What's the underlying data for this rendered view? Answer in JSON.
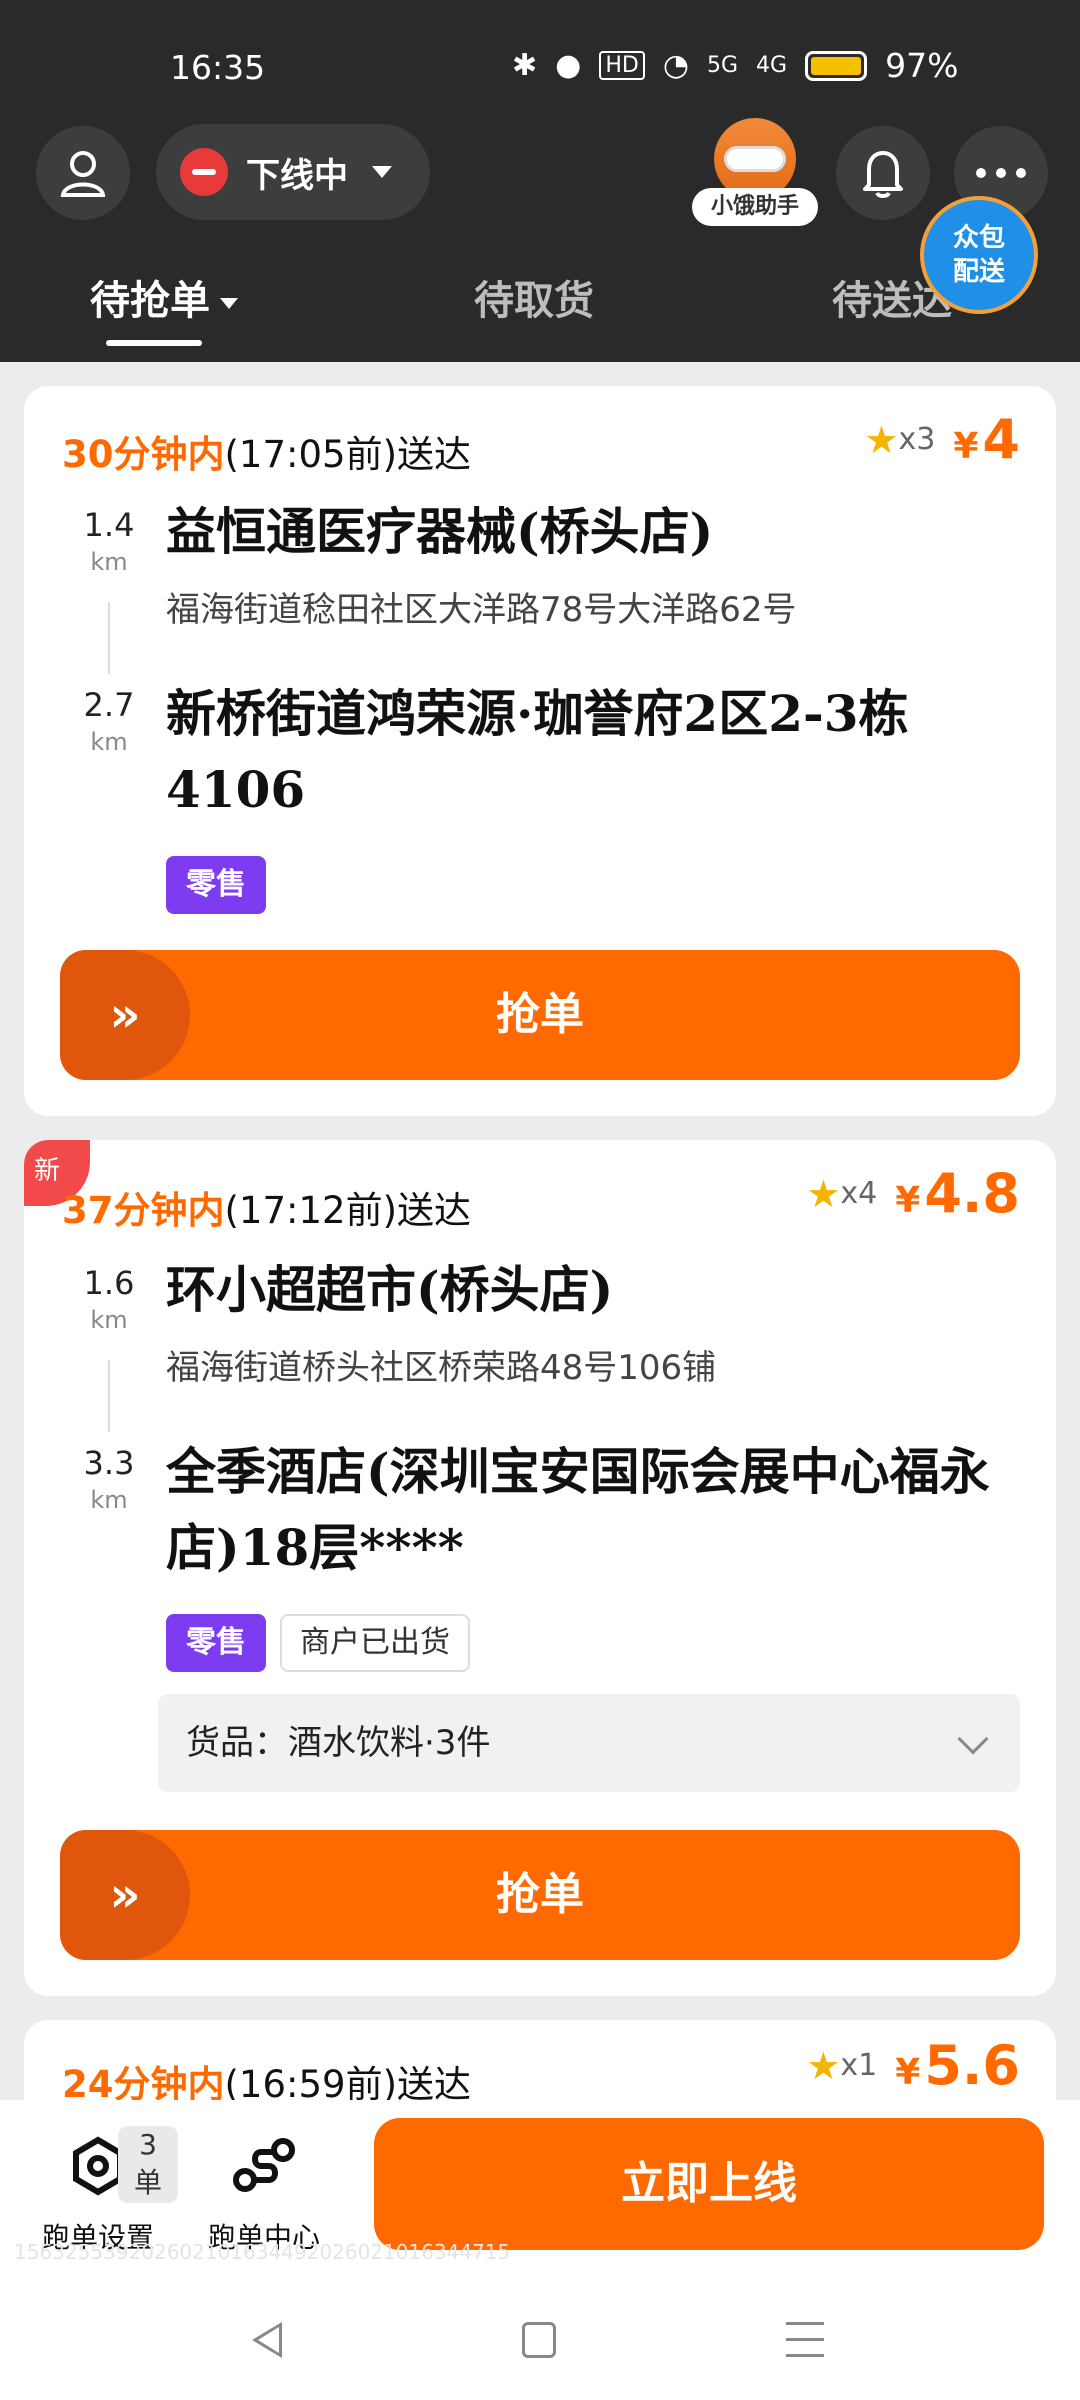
{
  "status_bar": {
    "time": "16:35",
    "network_5g": "5G",
    "network_4g": "4G",
    "hd": "HD",
    "battery": "97%"
  },
  "header": {
    "status_label": "下线中",
    "assistant_label": "小饿助手",
    "crowd_badge": "众包\n配送"
  },
  "tabs": [
    {
      "label": "待抢单",
      "active": true
    },
    {
      "label": "待取货",
      "active": false
    },
    {
      "label": "待送达",
      "active": false
    }
  ],
  "orders": [
    {
      "deliver_minutes": "30分钟内",
      "deliver_rest": "(17:05前)送达",
      "star_count": "x3",
      "currency": "¥",
      "price": "4",
      "pickup_distance": "1.4",
      "pickup_unit": "km",
      "pickup_name": "益恒通医疗器械(桥头店)",
      "pickup_address": "福海街道稔田社区大洋路78号大洋路62号",
      "drop_distance": "2.7",
      "drop_unit": "km",
      "drop_name": "新桥街道鸿荣源·珈誉府2区2-3栋 4106",
      "tags": [
        "零售"
      ],
      "grab_label": "抢单"
    },
    {
      "is_new": "新",
      "deliver_minutes": "37分钟内",
      "deliver_rest": "(17:12前)送达",
      "star_count": "x4",
      "currency": "¥",
      "price": "4.8",
      "pickup_distance": "1.6",
      "pickup_unit": "km",
      "pickup_name": "环小超超市(桥头店)",
      "pickup_address": "福海街道桥头社区桥荣路48号106铺",
      "drop_distance": "3.3",
      "drop_unit": "km",
      "drop_name": "全季酒店(深圳宝安国际会展中心福永店)18层****",
      "tags": [
        "零售",
        "商户已出货"
      ],
      "goods": "货品：酒水饮料·3件",
      "grab_label": "抢单"
    },
    {
      "deliver_minutes": "24分钟内",
      "deliver_rest": "(16:59前)送达",
      "star_count": "x1",
      "currency": "¥",
      "price": "5.6"
    }
  ],
  "bottom_bar": {
    "settings_label": "跑单设置",
    "settings_count": "3单",
    "center_label": "跑单中心",
    "online_button": "立即上线",
    "id_text": "156325539202602101634492026021016344715"
  }
}
